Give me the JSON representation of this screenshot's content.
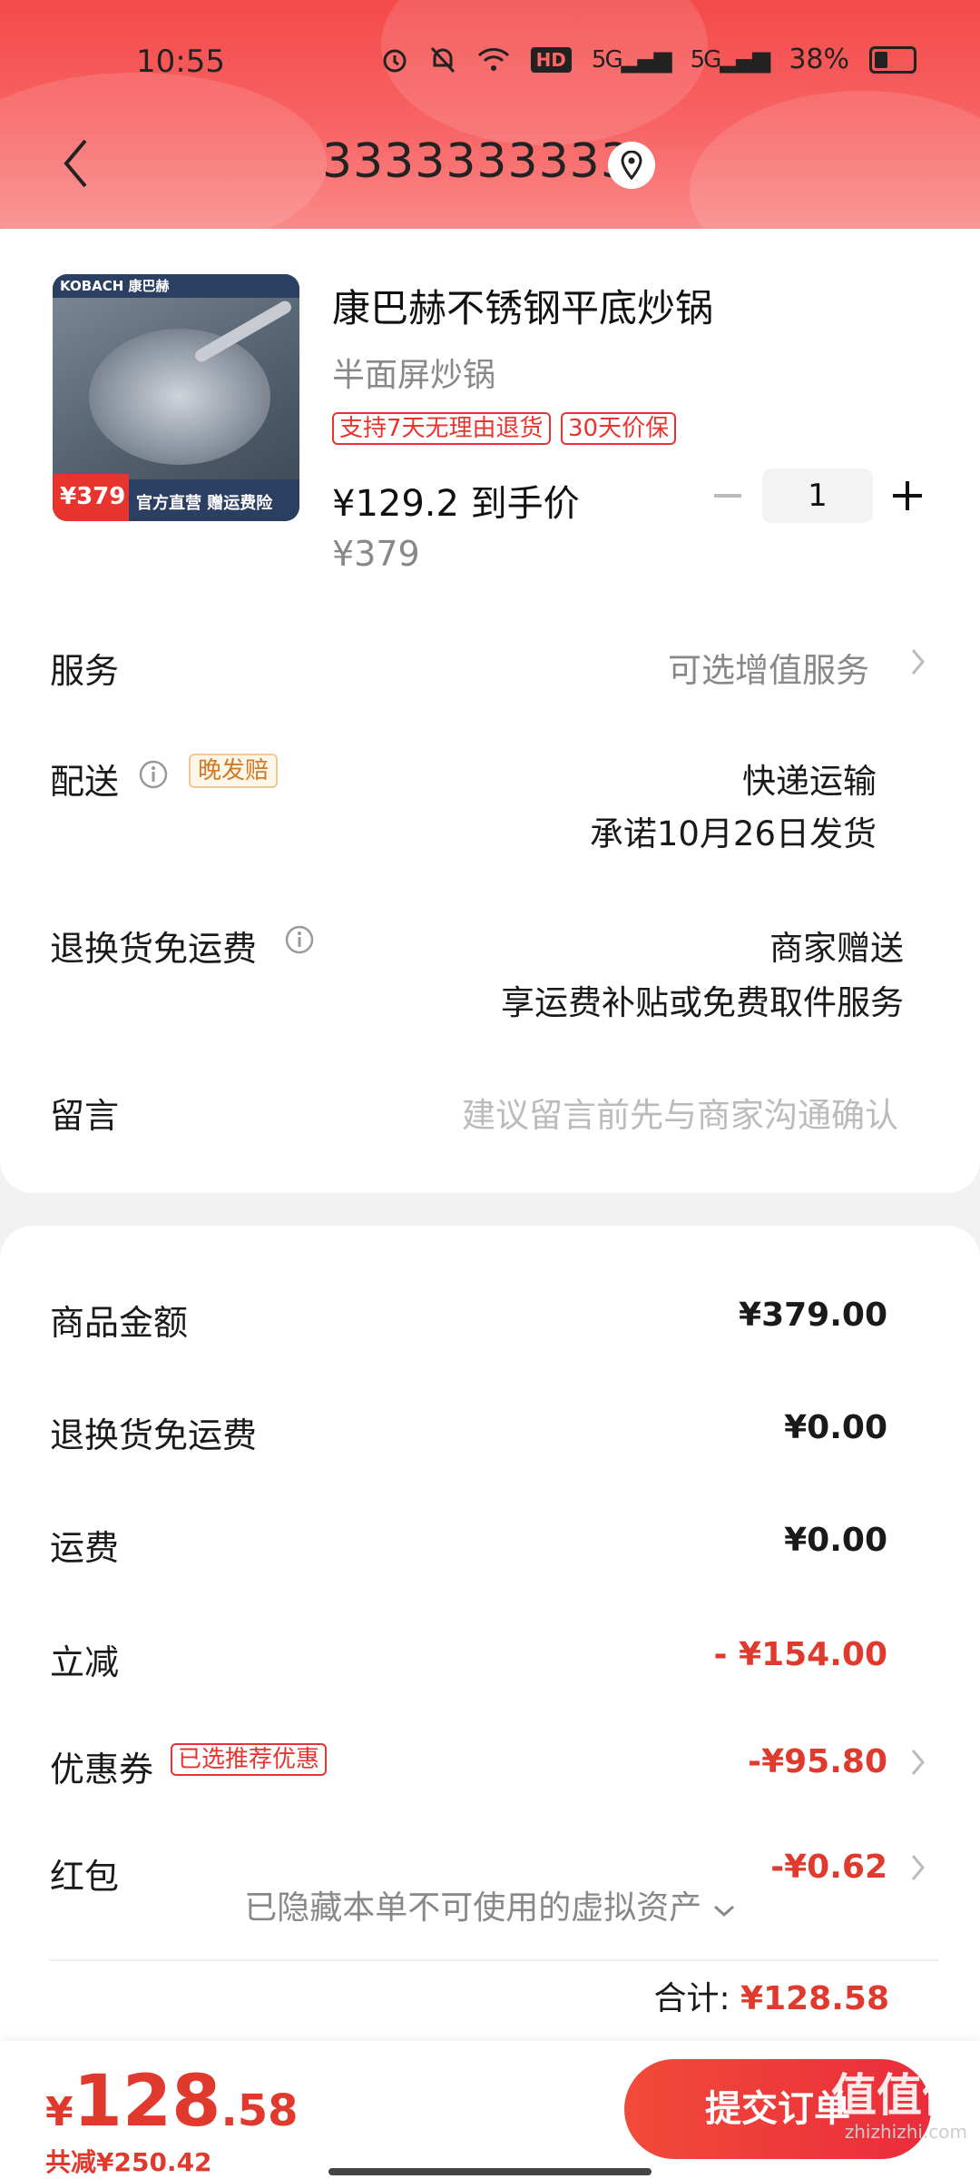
{
  "status_bar": {
    "time": "10:55",
    "signal1": "5G",
    "signal2": "5G",
    "battery": "38%",
    "hd": "HD"
  },
  "header": {
    "title": "3333333333"
  },
  "product": {
    "title": "康巴赫不锈钢平底炒锅",
    "subtitle": "半面屏炒锅",
    "tags": [
      "支持7天无理由退货",
      "30天价保"
    ],
    "price_text": "¥129.2 到手价",
    "original_price": "¥379",
    "quantity": "1",
    "image_brand": "KOBACH 康巴赫",
    "image_price": "379",
    "image_caption": "官方直营 赠运费险"
  },
  "rows": {
    "service_label": "服务",
    "service_value": "可选增值服务",
    "delivery_label": "配送",
    "delivery_tag": "晚发赔",
    "delivery_method": "快递运输",
    "delivery_promise": "承诺10月26日发货",
    "return_label": "退换货免运费",
    "return_value": "商家赠送",
    "return_detail": "享运费补贴或免费取件服务",
    "message_label": "留言",
    "message_placeholder": "建议留言前先与商家沟通确认"
  },
  "summary": {
    "goods_amount_label": "商品金额",
    "goods_amount": "¥379.00",
    "return_fee_label": "退换货免运费",
    "return_fee": "¥0.00",
    "shipping_label": "运费",
    "shipping": "¥0.00",
    "discount_label": "立减",
    "discount": "- ¥154.00",
    "coupon_label": "优惠券",
    "coupon_tag": "已选推荐优惠",
    "coupon": "-¥95.80",
    "redpacket_label": "红包",
    "redpacket": "-¥0.62",
    "hidden_assets": "已隐藏本单不可使用的虚拟资产",
    "total_label": "合计:",
    "total_value": "¥128.58"
  },
  "footer": {
    "currency": "¥",
    "total_int": "128",
    "total_dec": ".58",
    "saved": "共减¥250.42",
    "submit": "提交订单",
    "watermark": "值值值",
    "watermark_sub": "zhizhizhi.com"
  }
}
